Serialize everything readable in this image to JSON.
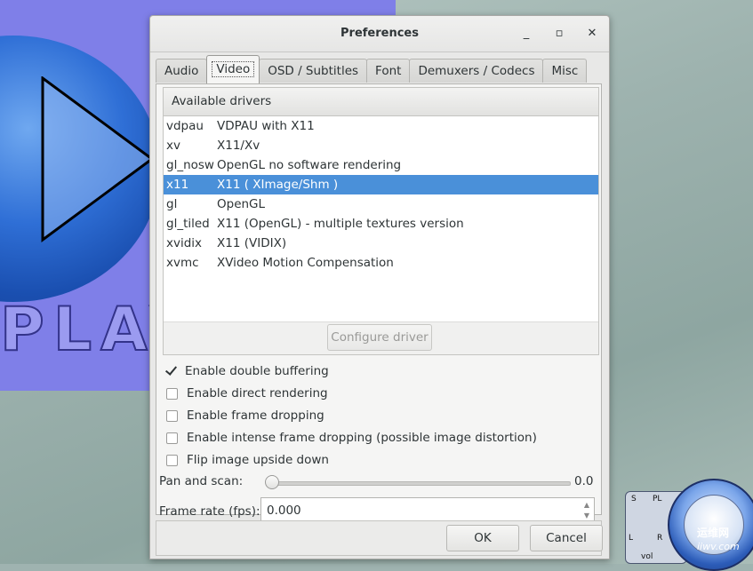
{
  "background": {
    "player_text": "PLAY",
    "mini_player": {
      "labels": [
        "S",
        "PL",
        "L",
        "R",
        "vol"
      ],
      "watermark_line1": "运维网",
      "watermark_line2": "iiwv.com"
    }
  },
  "dialog": {
    "title": "Preferences",
    "window_buttons": {
      "minimize": "_",
      "maximize": "▫",
      "close": "✕"
    },
    "tabs": [
      {
        "label": "Audio",
        "active": false
      },
      {
        "label": "Video",
        "active": true
      },
      {
        "label": "OSD / Subtitles",
        "active": false
      },
      {
        "label": "Font",
        "active": false
      },
      {
        "label": "Demuxers / Codecs",
        "active": false
      },
      {
        "label": "Misc",
        "active": false
      }
    ],
    "drivers": {
      "header": "Available drivers",
      "items": [
        {
          "name": "vdpau",
          "desc": "VDPAU with X11",
          "selected": false
        },
        {
          "name": "xv",
          "desc": "X11/Xv",
          "selected": false
        },
        {
          "name": "gl_nosw",
          "desc": "OpenGL no software rendering",
          "selected": false
        },
        {
          "name": "x11",
          "desc": "X11 ( XImage/Shm )",
          "selected": true
        },
        {
          "name": "gl",
          "desc": "OpenGL",
          "selected": false
        },
        {
          "name": "gl_tiled",
          "desc": "X11 (OpenGL) - multiple textures version",
          "selected": false
        },
        {
          "name": "xvidix",
          "desc": "X11 (VIDIX)",
          "selected": false
        },
        {
          "name": "xvmc",
          "desc": "XVideo Motion Compensation",
          "selected": false
        }
      ],
      "configure_button": "Configure driver"
    },
    "options": [
      {
        "label": "Enable double buffering",
        "checked": true
      },
      {
        "label": "Enable direct rendering",
        "checked": false
      },
      {
        "label": "Enable frame dropping",
        "checked": false
      },
      {
        "label": "Enable intense frame dropping (possible image distortion)",
        "checked": false
      },
      {
        "label": "Flip image upside down",
        "checked": false
      }
    ],
    "pan_scan": {
      "label": "Pan and scan:",
      "value": "0.0"
    },
    "frame_rate": {
      "label": "Frame rate (fps):",
      "value": "0.000"
    },
    "buttons": {
      "ok": "OK",
      "cancel": "Cancel"
    }
  }
}
